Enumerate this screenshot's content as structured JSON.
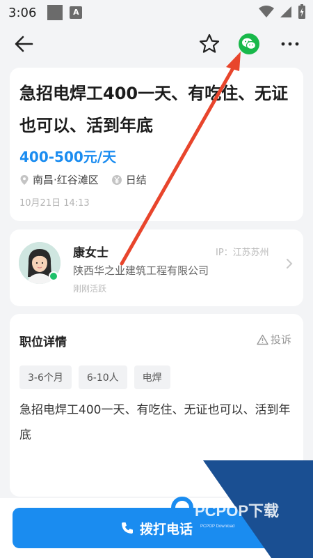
{
  "status_bar": {
    "time": "3:06",
    "badge": "A"
  },
  "job": {
    "title": "急招电焊工400一天、有吃住、无证也可以、活到年底",
    "salary": "400-500元/天",
    "location": "南昌·红谷滩区",
    "pay_cycle": "日结",
    "posted": "10月21日 14:13"
  },
  "contact": {
    "name": "康女士",
    "ip": "IP：江苏苏州",
    "company": "陕西华之业建筑工程有限公司",
    "active": "刚刚活跃"
  },
  "details": {
    "section_title": "职位详情",
    "report_label": "投诉",
    "tags": [
      "3-6个月",
      "6-10人",
      "电焊"
    ],
    "description": "急招电焊工400一天、有吃住、无证也可以、活到年底"
  },
  "call_button": {
    "label": "拨打电话"
  },
  "watermark": {
    "text": "PCPOP下载",
    "subtext": "PCPOP Download"
  },
  "colors": {
    "accent": "#1a8cf0",
    "wechat": "#18b84a",
    "online": "#1cc16a",
    "arrow": "#e8452c"
  }
}
